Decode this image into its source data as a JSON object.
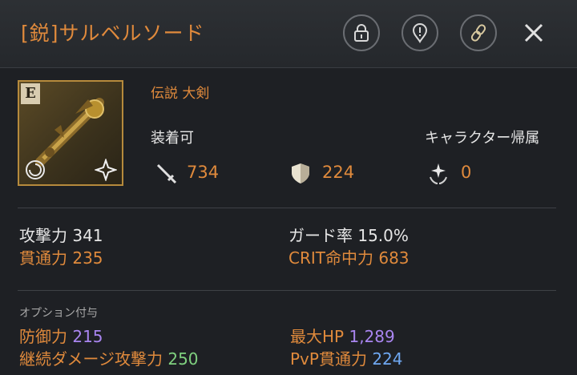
{
  "header": {
    "title": "[鋭]サルベルソード",
    "lock_icon": "lock-icon",
    "alert_icon": "exclamation-icon",
    "link_icon": "chain-link-icon",
    "close_icon": "close-icon"
  },
  "item": {
    "grade": "E",
    "type_label": "伝説  大剣",
    "equip_status": "装着可",
    "bind_status": "キャラクター帰属",
    "attack_value": "734",
    "defense_value": "224",
    "special_value": "0"
  },
  "base_stats": {
    "attack_label": "攻撃力",
    "attack": "341",
    "penetration_label": "貫通力",
    "penetration": "235",
    "guard_label": "ガード率",
    "guard": "15.0%",
    "crit_label": "CRIT命中力",
    "crit": "683"
  },
  "options": {
    "section_label": "オプション付与",
    "defense_label": "防御力",
    "defense": "215",
    "maxhp_label": "最大HP",
    "maxhp": "1,289",
    "dot_label": "継続ダメージ攻撃力",
    "dot": "250",
    "pvp_label": "PvP貫通力",
    "pvp": "224"
  },
  "colors": {
    "accent_orange": "#e08a3c",
    "purple": "#a985f0",
    "green": "#7fd07f",
    "blue": "#6fa8f2"
  }
}
